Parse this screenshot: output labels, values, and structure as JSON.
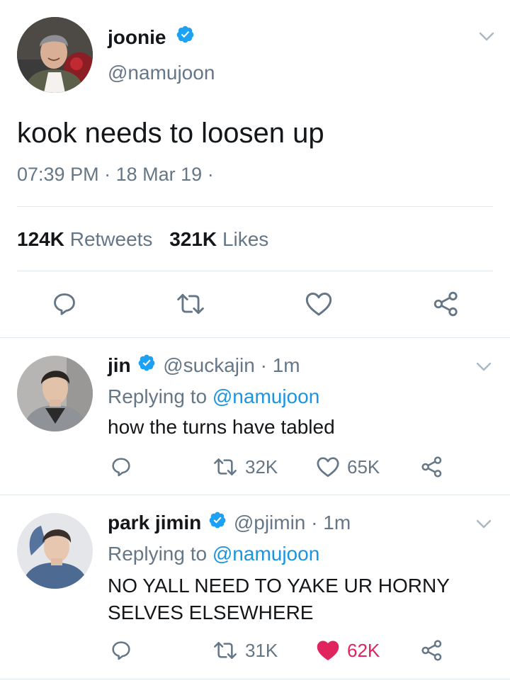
{
  "main_tweet": {
    "name": "joonie",
    "handle": "@namujoon",
    "text": "kook needs to loosen up",
    "time": "07:39 PM",
    "sep1": "·",
    "date": "18 Mar 19",
    "sep2": "·",
    "retweets_count": "124K",
    "retweets_label": "Retweets",
    "likes_count": "321K",
    "likes_label": "Likes"
  },
  "replies": [
    {
      "name": "jin",
      "handle": "@suckajin",
      "sep": "·",
      "time": "1m",
      "replying_label": "Replying to",
      "replying_handle": "@namujoon",
      "text_lines": [
        "how the turns have tabled"
      ],
      "retweets": "32K",
      "likes": "65K",
      "liked": false
    },
    {
      "name": "park jimin",
      "handle": "@pjimin",
      "sep": "·",
      "time": "1m",
      "replying_label": "Replying to",
      "replying_handle": "@namujoon",
      "text_lines": [
        "NO YALL NEED TO YAKE UR HORNY",
        "SELVES ELSEWHERE"
      ],
      "retweets": "31K",
      "likes": "62K",
      "liked": true
    }
  ],
  "colors": {
    "verified_blue": "#1da1f2",
    "link_blue": "#1b95e0",
    "like_red": "#e0245e",
    "muted_gray": "#657786",
    "divider": "#e1e8ed"
  },
  "icons": [
    "verified-badge-icon",
    "chevron-down-icon",
    "reply-icon",
    "retweet-icon",
    "heart-icon",
    "share-icon"
  ]
}
